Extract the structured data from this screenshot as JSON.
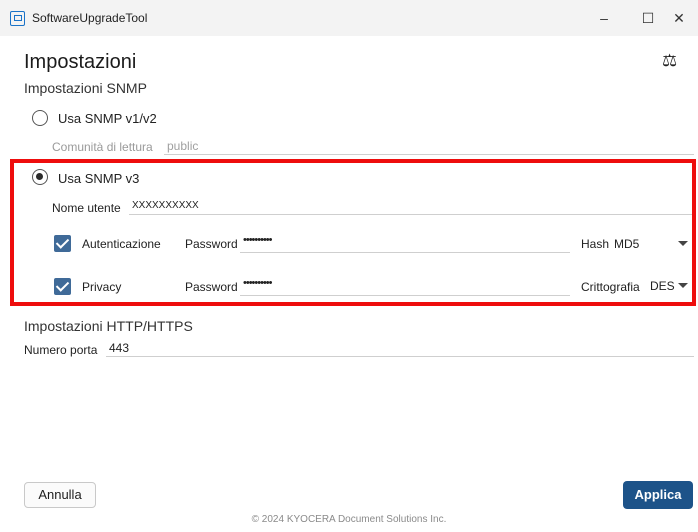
{
  "window": {
    "title": "SoftwareUpgradeTool",
    "minimize": "–",
    "maximize": "☐",
    "close": "✕"
  },
  "page": {
    "title": "Impostazioni",
    "balance_icon": "⚖"
  },
  "snmp": {
    "section_title": "Impostazioni SNMP",
    "v1v2_label": "Usa SNMP v1/v2",
    "v1v2_selected": false,
    "community_label": "Comunità di lettura",
    "community_value": "public",
    "v3_label": "Usa SNMP v3",
    "v3_selected": true,
    "username_label": "Nome utente",
    "username_value": "XXXXXXXXXX",
    "auth": {
      "label": "Autenticazione",
      "checked": true,
      "password_label": "Password",
      "password_value": "••••••••••",
      "hash_label": "Hash",
      "hash_value": "MD5"
    },
    "privacy": {
      "label": "Privacy",
      "checked": true,
      "password_label": "Password",
      "password_value": "••••••••••",
      "crypto_label": "Crittografia",
      "crypto_value": "DES"
    }
  },
  "http": {
    "section_title": "Impostazioni HTTP/HTTPS",
    "port_label": "Numero porta",
    "port_value": "443"
  },
  "buttons": {
    "cancel": "Annulla",
    "apply": "Applica"
  },
  "footer": "© 2024 KYOCERA Document Solutions Inc.",
  "colors": {
    "highlight": "#ee0d0d",
    "accent": "#1d5389",
    "checkbox": "#3f6a98"
  }
}
